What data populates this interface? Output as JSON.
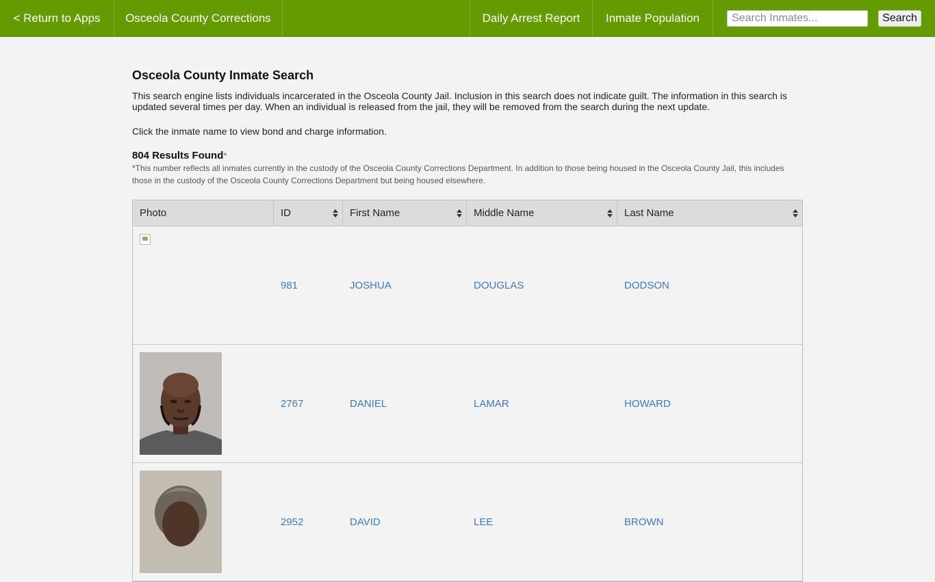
{
  "nav": {
    "return_label": "< Return to Apps",
    "brand": "Osceola County Corrections",
    "daily_arrest_report": "Daily Arrest Report",
    "inmate_population": "Inmate Population",
    "search_placeholder": "Search Inmates...",
    "search_button": "Search"
  },
  "page": {
    "title": "Osceola County Inmate Search",
    "intro": "This search engine lists individuals incarcerated in the Osceola County Jail. Inclusion in this search does not indicate guilt. The information in this search is updated several times per day. When an individual is released from the jail, they will be removed from the search during the next update.",
    "click_hint": "Click the inmate name to view bond and charge information.",
    "results_count": "804 Results Found",
    "results_asterisk": "*",
    "footnote": "*This number reflects all inmates currently in the custody of the Osceola County Corrections Department. In addition to those being housed in the Osceola County Jail, this includes those in the custody of the Osceola County Corrections Department but being housed elsewhere."
  },
  "table": {
    "headers": [
      "Photo",
      "ID",
      "First Name",
      "Middle Name",
      "Last Name"
    ],
    "rows": [
      {
        "photo": "broken-image",
        "id": "981",
        "first": "JOSHUA",
        "middle": "DOUGLAS",
        "last": "DODSON"
      },
      {
        "photo": "mugshot",
        "id": "2767",
        "first": "DANIEL",
        "middle": "LAMAR",
        "last": "HOWARD"
      },
      {
        "photo": "mugshot",
        "id": "2952",
        "first": "DAVID",
        "middle": "LEE",
        "last": "BROWN"
      }
    ]
  },
  "colors": {
    "navbar": "#649c00",
    "link": "#3b7bbf",
    "background": "#f3f3f3",
    "table_header": "#dcdcdc"
  }
}
